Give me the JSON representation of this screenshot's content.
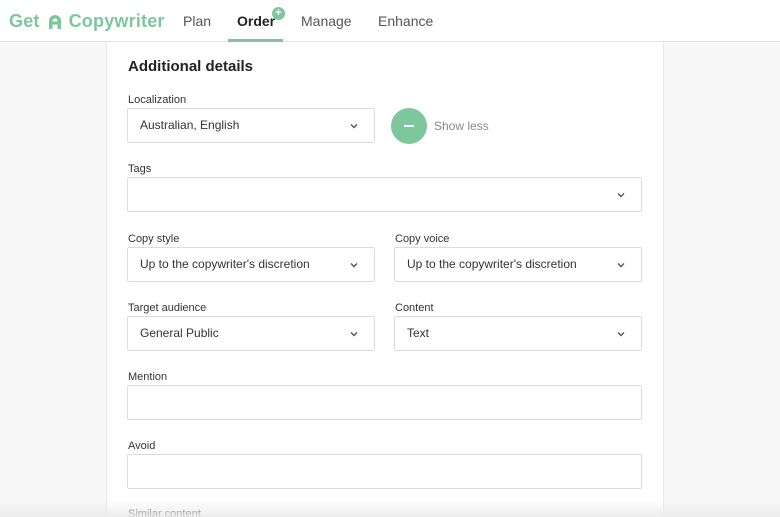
{
  "brand": {
    "name_part1": "Get",
    "name_part2": "Copywriter",
    "color": "#7cc79b"
  },
  "nav": {
    "items": [
      {
        "label": "Plan",
        "active": false
      },
      {
        "label": "Order",
        "active": true,
        "badge": "+"
      },
      {
        "label": "Manage",
        "active": false
      },
      {
        "label": "Enhance",
        "active": false
      }
    ]
  },
  "form": {
    "title": "Additional details",
    "localization": {
      "label": "Localization",
      "value": "Australian, English"
    },
    "show_less": {
      "label": "Show less"
    },
    "tags": {
      "label": "Tags",
      "value": ""
    },
    "copy_style": {
      "label": "Copy style",
      "value": "Up to the copywriter's discretion"
    },
    "copy_voice": {
      "label": "Copy voice",
      "value": "Up to the copywriter's discretion"
    },
    "target_audience": {
      "label": "Target audience",
      "value": "General Public"
    },
    "content": {
      "label": "Content",
      "value": "Text"
    },
    "mention": {
      "label": "Mention",
      "value": ""
    },
    "avoid": {
      "label": "Avoid",
      "value": ""
    },
    "similar_content": {
      "label": "Similar content"
    }
  },
  "icons": {
    "chevron": "chevron-down-icon",
    "minus": "minus-icon",
    "logo": "logo-icon"
  }
}
